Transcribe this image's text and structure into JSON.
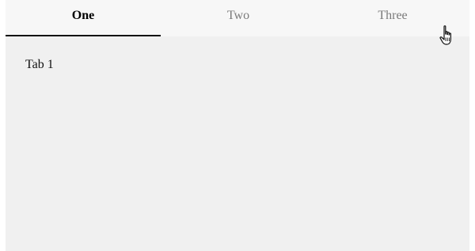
{
  "tabs": [
    {
      "label": "One",
      "active": true
    },
    {
      "label": "Two",
      "active": false
    },
    {
      "label": "Three",
      "active": false
    }
  ],
  "panel": {
    "content": "Tab 1"
  },
  "colors": {
    "tabbar_bg": "#f7f7f7",
    "panel_bg": "#f0f0f0",
    "active_text": "#000000",
    "inactive_text": "#7a7a7a",
    "indicator": "#111111"
  },
  "icons": {
    "cursor": "hand-pointer-cursor-icon"
  }
}
